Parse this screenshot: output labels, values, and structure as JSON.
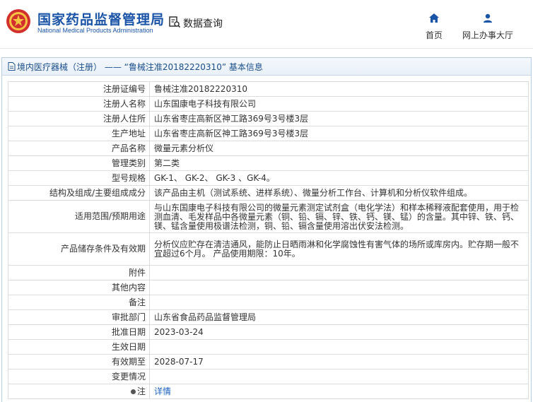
{
  "header": {
    "brand_cn": "国家药品监督管理局",
    "brand_en": "National Medical Products Administration",
    "search_label": "数据查询",
    "nav": {
      "home": "首页",
      "hall": "网上办事大厅"
    }
  },
  "colors": {
    "brand": "#1a54a7",
    "accent": "#1a62c0"
  },
  "panel": {
    "title": "境内医疗器械（注册） —— “鲁械注准20182220310” 基本信息"
  },
  "fields": [
    {
      "label": "注册证编号",
      "value": "鲁械注准20182220310"
    },
    {
      "label": "注册人名称",
      "value": "山东国康电子科技有限公司"
    },
    {
      "label": "注册人住所",
      "value": "山东省枣庄高新区神工路369号3号楼3层"
    },
    {
      "label": "生产地址",
      "value": "山东省枣庄高新区神工路369号3号楼3层"
    },
    {
      "label": "产品名称",
      "value": "微量元素分析仪"
    },
    {
      "label": "管理类别",
      "value": "第二类"
    },
    {
      "label": "型号规格",
      "value": "GK-1、 GK-2、 GK-3 、GK-4。"
    },
    {
      "label": "结构及组成/主要组成成分",
      "value": "该产品由主机（测试系统、进样系统）、微量分析工作台、计算机和分析仪软件组成。"
    },
    {
      "label": "适用范围/预期用途",
      "value": "与山东国康电子科技有限公司的微量元素测定试剂盒（电化学法）和样本稀释液配套使用，用于检测血清、毛发样品中各微量元素（铜、铅、镉、锌、铁、钙、镁、锰）的含量。其中锌、铁、钙、镁、锰含量使用极谱法检测，铜、铅、镉含量使用溶出伏安法检测。"
    },
    {
      "label": "产品储存条件及有效期",
      "value": "分析仪应贮存在清洁通风，能防止日晒雨淋和化学腐蚀性有害气体的场所或库房内。贮存期一般不宜超过6个月。 产品使用期限：10年。"
    },
    {
      "label": "附件",
      "value": ""
    },
    {
      "label": "其他内容",
      "value": ""
    },
    {
      "label": "备注",
      "value": ""
    },
    {
      "label": "审批部门",
      "value": "山东省食品药品监督管理局"
    },
    {
      "label": "批准日期",
      "value": "2023-03-24"
    },
    {
      "label": "生效日期",
      "value": ""
    },
    {
      "label": "有效期至",
      "value": "2028-07-17"
    },
    {
      "label": "变更情况",
      "value": ""
    },
    {
      "label": "注",
      "value": "详情"
    }
  ]
}
